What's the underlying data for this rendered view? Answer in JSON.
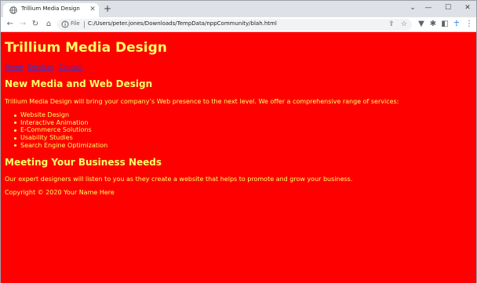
{
  "browser": {
    "tab": {
      "title": "Trillium Media Design"
    },
    "address": {
      "label": "File",
      "url": "C:/Users/peter.jones/Downloads/TempData/nppCommunity/blah.html"
    },
    "colors": {
      "tabstrip": "#dee1e6",
      "toolbar": "#ffffff",
      "accent": "#1a73e8"
    }
  },
  "page": {
    "colors": {
      "background": "#ff0000",
      "text": "#ffff66",
      "link": "#3333cc"
    },
    "title": "Trillium Media Design",
    "nav": [
      "Home",
      "Services",
      "Contact"
    ],
    "section1": {
      "heading": "New Media and Web Design",
      "text": "Trillium Media Design will bring your company’s Web presence to the next level. We offer a comprehensive range of services:",
      "services": [
        "Website Design",
        "Interactive Animation",
        "E-Commerce Solutions",
        "Usability Studies",
        "Search Engine Optimization"
      ]
    },
    "section2": {
      "heading": "Meeting Your Business Needs",
      "text": "Our expert designers will listen to you as they create a website that helps to promote and grow your business."
    },
    "footer": "Copyright © 2020 Your Name Here"
  }
}
